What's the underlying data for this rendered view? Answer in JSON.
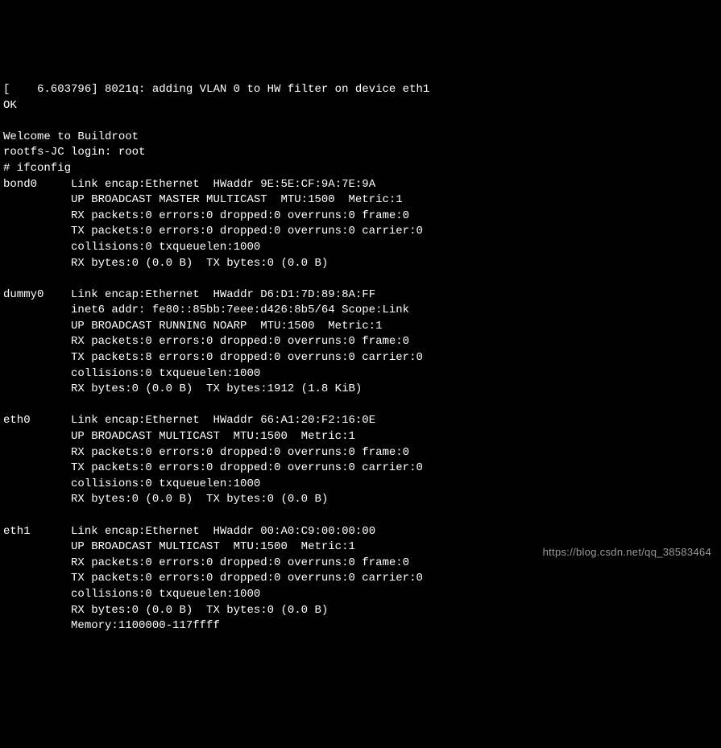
{
  "boot": {
    "kmsg": "[    6.603796] 8021q: adding VLAN 0 to HW filter on device eth1",
    "ok": "OK",
    "blank": "",
    "welcome": "Welcome to Buildroot",
    "login_line": "rootfs-JC login: root",
    "prompt": "# ifconfig"
  },
  "interfaces": {
    "bond0": {
      "name": "bond0",
      "l1": "Link encap:Ethernet  HWaddr 9E:5E:CF:9A:7E:9A",
      "l2": "UP BROADCAST MASTER MULTICAST  MTU:1500  Metric:1",
      "l3": "RX packets:0 errors:0 dropped:0 overruns:0 frame:0",
      "l4": "TX packets:0 errors:0 dropped:0 overruns:0 carrier:0",
      "l5": "collisions:0 txqueuelen:1000",
      "l6": "RX bytes:0 (0.0 B)  TX bytes:0 (0.0 B)"
    },
    "dummy0": {
      "name": "dummy0",
      "l1": "Link encap:Ethernet  HWaddr D6:D1:7D:89:8A:FF",
      "l2": "inet6 addr: fe80::85bb:7eee:d426:8b5/64 Scope:Link",
      "l3": "UP BROADCAST RUNNING NOARP  MTU:1500  Metric:1",
      "l4": "RX packets:0 errors:0 dropped:0 overruns:0 frame:0",
      "l5": "TX packets:8 errors:0 dropped:0 overruns:0 carrier:0",
      "l6": "collisions:0 txqueuelen:1000",
      "l7": "RX bytes:0 (0.0 B)  TX bytes:1912 (1.8 KiB)"
    },
    "eth0": {
      "name": "eth0",
      "l1": "Link encap:Ethernet  HWaddr 66:A1:20:F2:16:0E",
      "l2": "UP BROADCAST MULTICAST  MTU:1500  Metric:1",
      "l3": "RX packets:0 errors:0 dropped:0 overruns:0 frame:0",
      "l4": "TX packets:0 errors:0 dropped:0 overruns:0 carrier:0",
      "l5": "collisions:0 txqueuelen:1000",
      "l6": "RX bytes:0 (0.0 B)  TX bytes:0 (0.0 B)"
    },
    "eth1": {
      "name": "eth1",
      "l1": "Link encap:Ethernet  HWaddr 00:A0:C9:00:00:00",
      "l2": "UP BROADCAST MULTICAST  MTU:1500  Metric:1",
      "l3": "RX packets:0 errors:0 dropped:0 overruns:0 frame:0",
      "l4": "TX packets:0 errors:0 dropped:0 overruns:0 carrier:0",
      "l5": "collisions:0 txqueuelen:1000",
      "l6": "RX bytes:0 (0.0 B)  TX bytes:0 (0.0 B)",
      "l7": "Memory:1100000-117ffff"
    }
  },
  "watermark": "https://blog.csdn.net/qq_38583464"
}
